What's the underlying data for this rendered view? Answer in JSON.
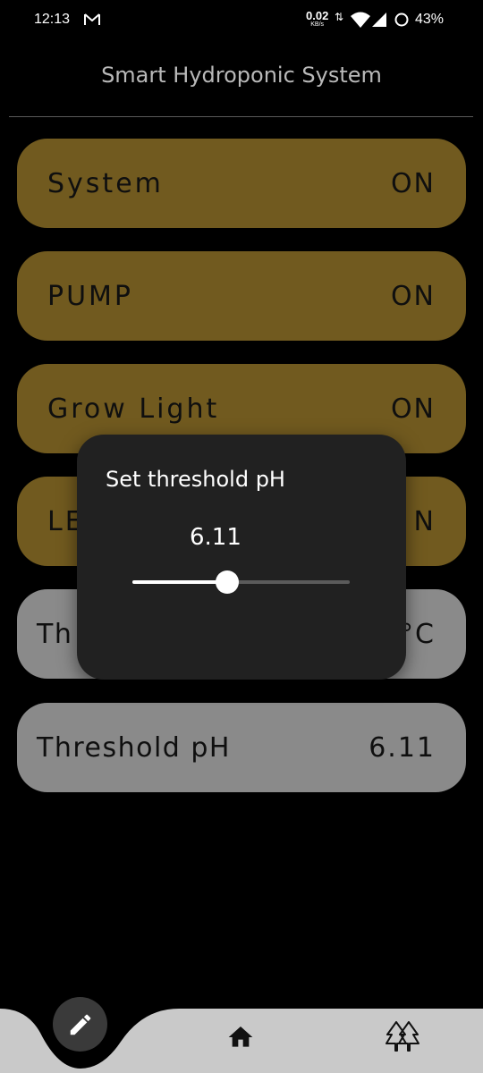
{
  "status_bar": {
    "time": "12:13",
    "net_speed": "0.02",
    "net_unit": "KB/s",
    "battery": "43%",
    "icons": [
      "gmail-icon",
      "data-arrows-icon",
      "wifi-icon",
      "signal-icon",
      "battery-ring-icon"
    ]
  },
  "header": {
    "title": "Smart Hydroponic System"
  },
  "cards": [
    {
      "label": "System",
      "value": "ON"
    },
    {
      "label": "PUMP",
      "value": "ON"
    },
    {
      "label": "Grow Light",
      "value": "ON"
    },
    {
      "label": "LE",
      "value": "N"
    },
    {
      "label": "Th",
      "value": "°C"
    },
    {
      "label": "Threshold pH",
      "value": "6.11"
    }
  ],
  "dialog": {
    "title": "Set threshold pH",
    "value": "6.11",
    "slider_fraction": 0.435
  },
  "bottom_nav": {
    "items": [
      "edit-icon",
      "home-icon",
      "trees-icon"
    ]
  },
  "colors": {
    "gold_card": "#715a1f",
    "grey_card": "#8a8a8a",
    "dialog_bg": "#212121",
    "nav_bg": "#c9c9c9"
  }
}
